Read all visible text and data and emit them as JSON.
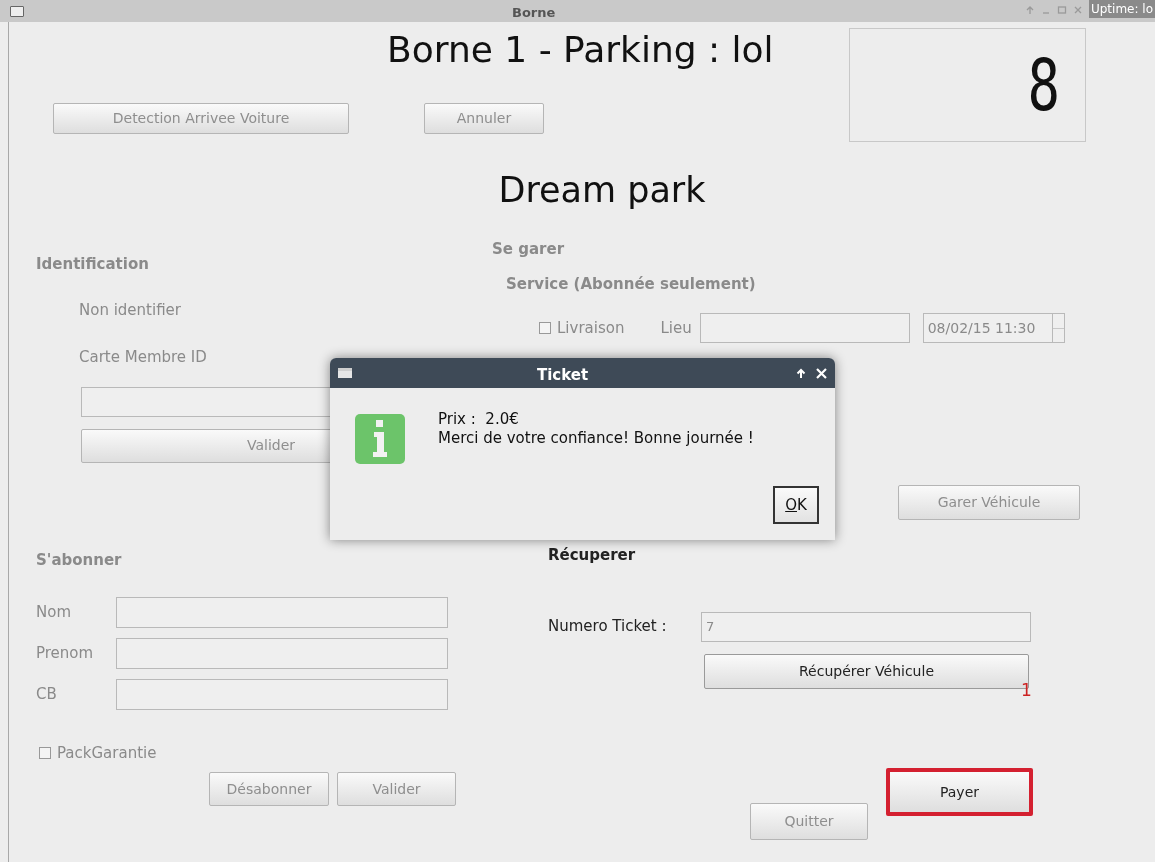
{
  "window": {
    "title": "Borne",
    "desktop_text": "Uptime: lo"
  },
  "header": {
    "title": "Borne 1 - Parking : lol",
    "buttons": [
      {
        "label": "Detection Arrivee Voiture",
        "disabled": true
      },
      {
        "label": "Annuler",
        "disabled": true
      }
    ],
    "counter": "8"
  },
  "brand": "Dream park",
  "identification": {
    "title": "Identification",
    "disabled": true,
    "status": "Non identifier",
    "field_label": "Carte Membre ID",
    "button": {
      "label": "Valider",
      "disabled": true
    }
  },
  "se_garer": {
    "title": "Se garer",
    "service_title": "Service (Abonnée seulement)",
    "disabled": true,
    "livraison": {
      "label": "Livraison",
      "checked": false
    },
    "lieu_label": "Lieu",
    "datetime": "08/02/15 11:30",
    "button": {
      "label": "Garer Véhicule",
      "disabled": true
    }
  },
  "abonner": {
    "title": "S'abonner",
    "disabled": true,
    "fields": [
      {
        "label": "Nom"
      },
      {
        "label": "Prenom"
      },
      {
        "label": "CB"
      }
    ],
    "pack": {
      "label": "PackGarantie",
      "checked": false
    },
    "buttons": [
      {
        "label": "Désabonner",
        "disabled": true
      },
      {
        "label": "Valider",
        "disabled": true
      }
    ]
  },
  "recuperer": {
    "title": "Récuperer",
    "disabled": false,
    "ticket_label": "Numero Ticket :",
    "ticket_value": "7",
    "button": {
      "label": "Récupérer Véhicule",
      "disabled": false
    }
  },
  "annotation": "1",
  "payer": {
    "label": "Payer",
    "disabled": false,
    "highlighted": true
  },
  "quitter": {
    "label": "Quitter",
    "disabled": true
  },
  "dialog": {
    "title": "Ticket",
    "lines": [
      "Prix :  2.0€",
      "Merci de votre confiance! Bonne journée !"
    ],
    "button": "OK"
  }
}
